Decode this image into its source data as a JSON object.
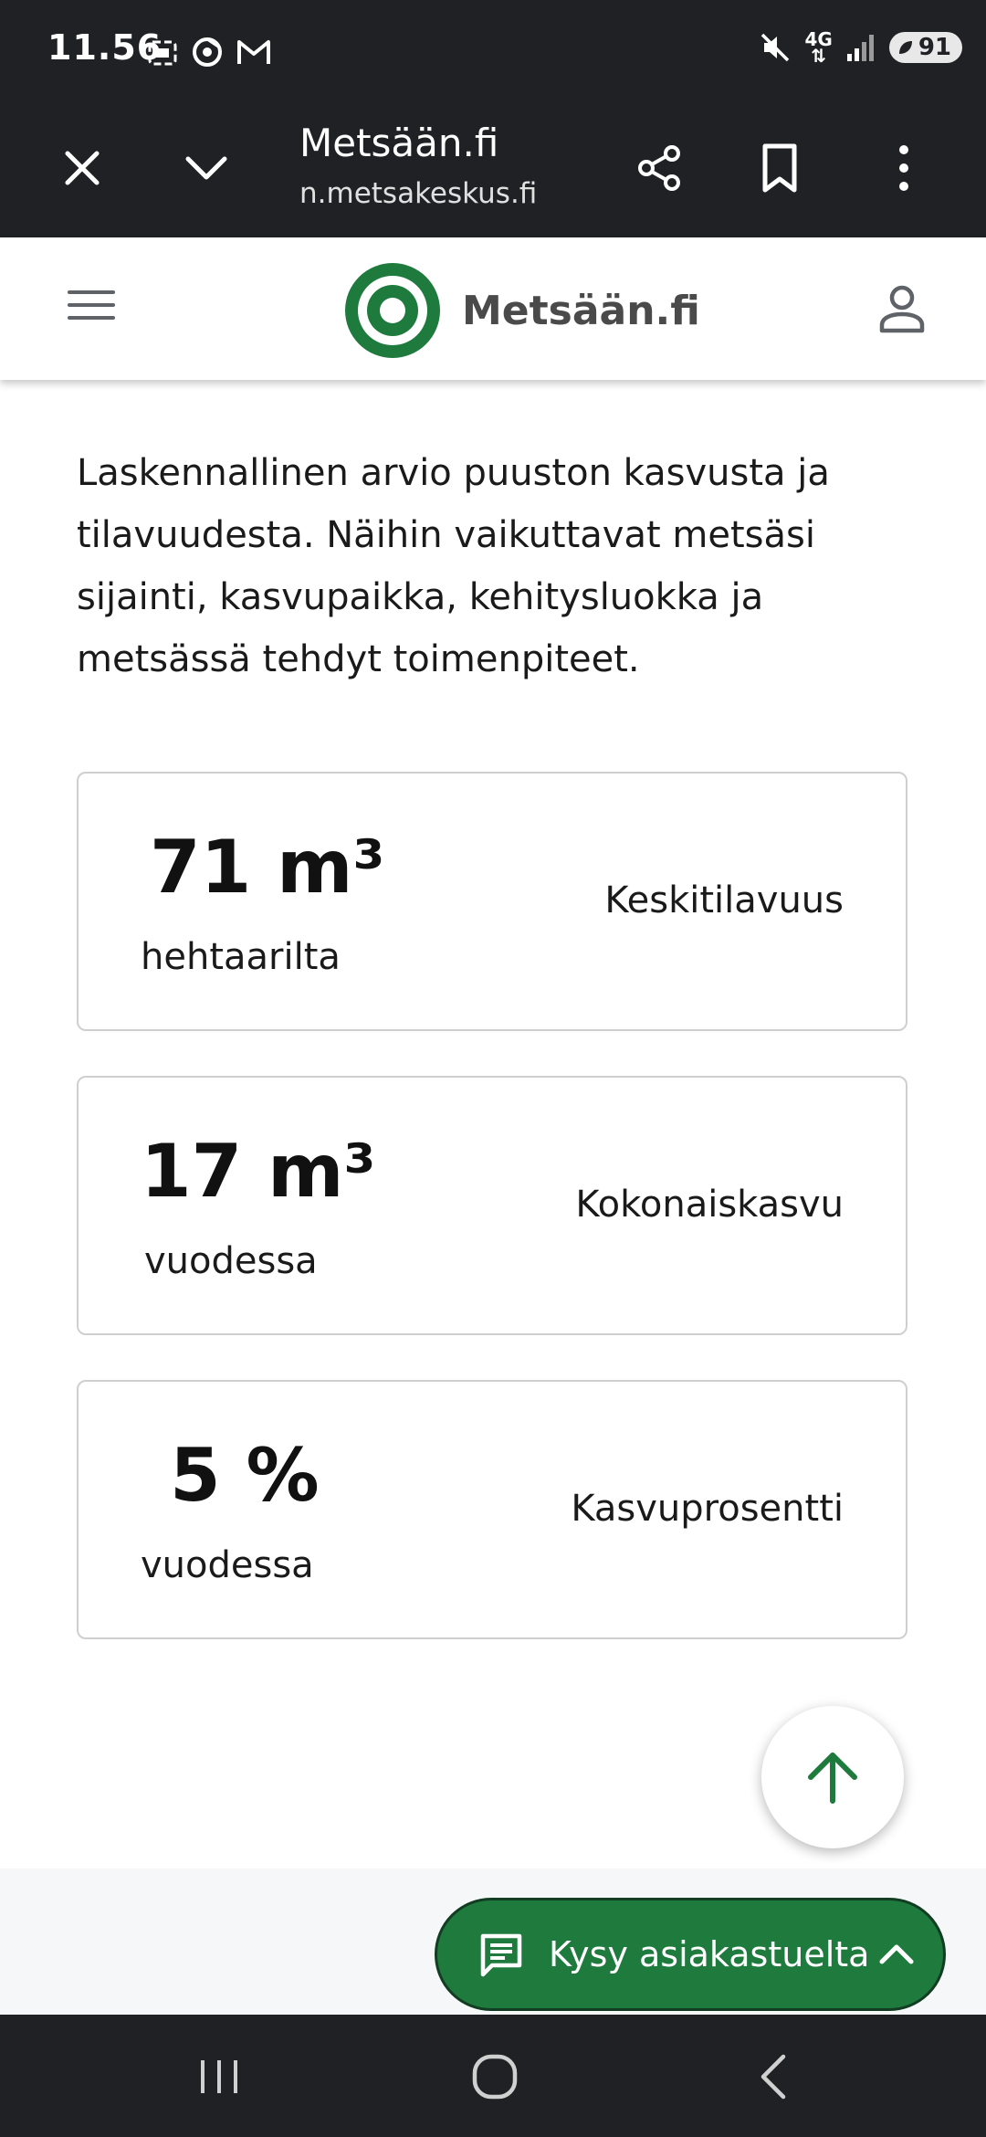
{
  "status_bar": {
    "time": "11.56",
    "network": "4G",
    "battery": "91"
  },
  "browser": {
    "title": "Metsään.fi",
    "url": "n.metsakeskus.fi"
  },
  "site": {
    "logo_text": "Metsään.fi",
    "brand_color": "#1f7a3d"
  },
  "content": {
    "intro": "Laskennallinen arvio puuston kasvusta ja tilavuudesta. Näihin vaikuttavat metsäsi sijainti, kasvupaikka, kehitysluokka ja metsässä tehdyt toimenpiteet.",
    "cards": [
      {
        "value": "71 m³",
        "unit": "hehtaarilta",
        "label": "Keskitilavuus"
      },
      {
        "value": "17 m³",
        "unit": "vuodessa",
        "label": "Kokonaiskasvu"
      },
      {
        "value": "5 %",
        "unit": "vuodessa",
        "label": "Kasvuprosentti"
      }
    ]
  },
  "chat": {
    "label": "Kysy asiakastuelta"
  }
}
